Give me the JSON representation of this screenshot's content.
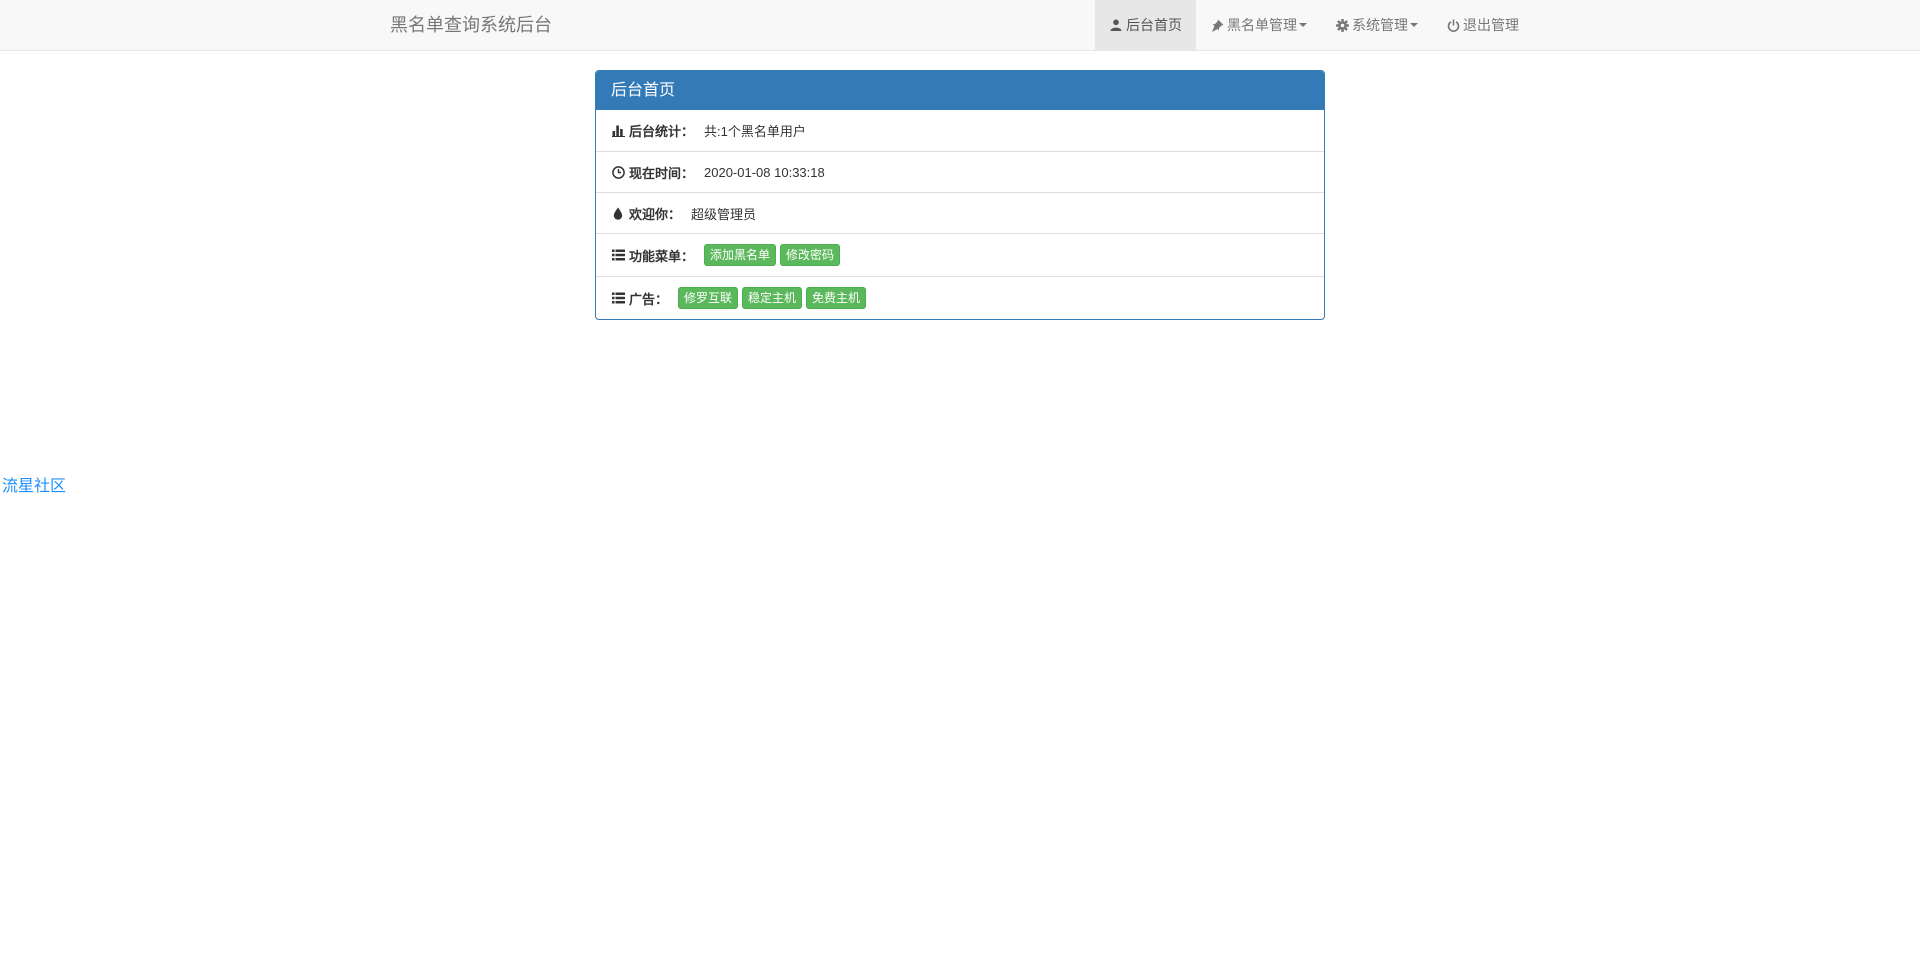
{
  "navbar": {
    "brand": "黑名单查询系统后台",
    "items": [
      {
        "label": "后台首页",
        "icon": "user-icon",
        "active": true
      },
      {
        "label": "黑名单管理",
        "icon": "pushpin-icon",
        "dropdown": true
      },
      {
        "label": "系统管理",
        "icon": "gear-icon",
        "dropdown": true
      },
      {
        "label": "退出管理",
        "icon": "power-icon"
      }
    ]
  },
  "panel": {
    "title": "后台首页",
    "stats_label": "后台统计：",
    "stats_value": "共:1个黑名单用户",
    "time_label": "现在时间：",
    "time_value": "2020-01-08 10:33:18",
    "welcome_label": "欢迎你：",
    "welcome_value": "超级管理员",
    "menu_label": "功能菜单：",
    "menu_buttons": [
      "添加黑名单",
      "修改密码"
    ],
    "ads_label": "广告：",
    "ads_buttons": [
      "修罗互联",
      "稳定主机",
      "免费主机"
    ]
  },
  "side_link": "流星社区",
  "colors": {
    "primary": "#337ab7",
    "success": "#5cb85c",
    "navbar_bg": "#f8f8f8",
    "link": "#1e90ff"
  }
}
